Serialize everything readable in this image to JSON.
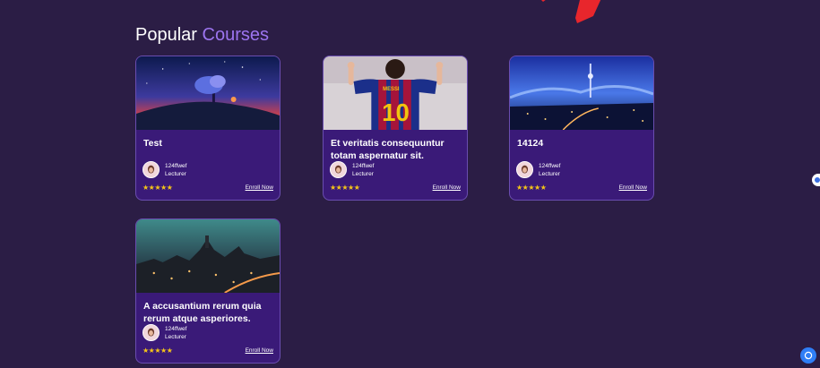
{
  "section": {
    "title_main": "Popular",
    "title_accent": "Courses"
  },
  "courses": [
    {
      "title": "Test",
      "author": "124ffwef",
      "role": "Lecturer",
      "rating": "★★★★★",
      "cta": "Enroll Now"
    },
    {
      "title": "Et veritatis consequuntur totam aspernatur sit.",
      "author": "124ffwef",
      "role": "Lecturer",
      "rating": "★★★★★",
      "cta": "Enroll Now"
    },
    {
      "title": "14124",
      "author": "124ffwef",
      "role": "Lecturer",
      "rating": "★★★★★",
      "cta": "Enroll Now"
    },
    {
      "title": "A accusantium rerum quia rerum atque asperiores.",
      "author": "124ffwef",
      "role": "Lecturer",
      "rating": "★★★★★",
      "cta": "Enroll Now"
    }
  ],
  "colors": {
    "background": "#2b1d45",
    "card": "#3a1a78",
    "accent": "#9d75f0",
    "star": "#f5c518",
    "deco": "#e8262c",
    "chat": "#2f7ef6"
  },
  "icons": {
    "chat": "chat-icon",
    "star": "star-icon",
    "avatar": "avatar"
  }
}
